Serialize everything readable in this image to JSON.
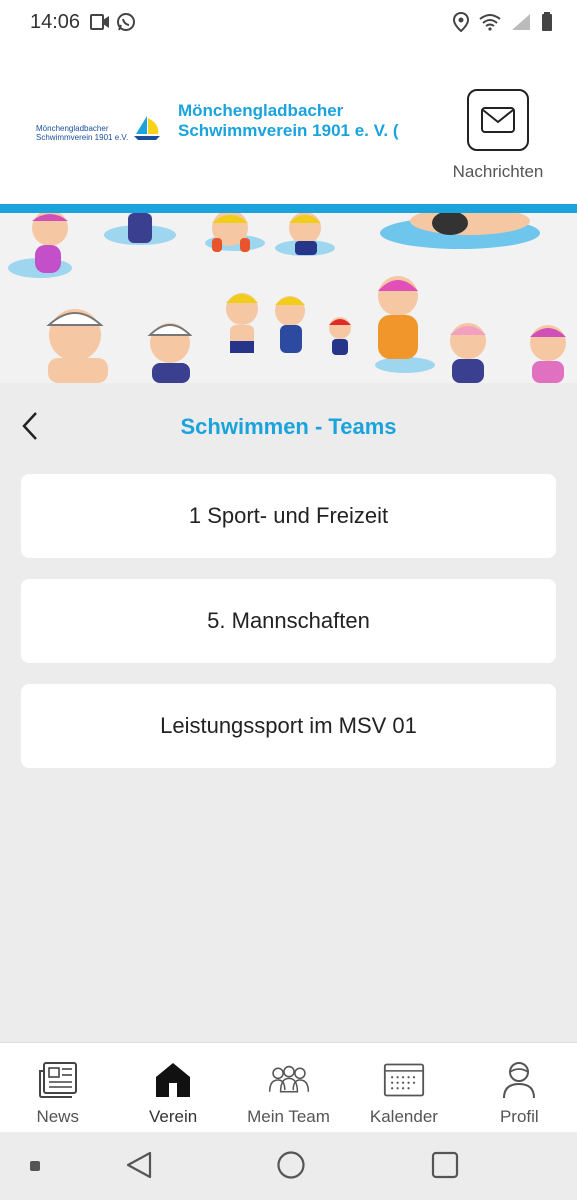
{
  "status": {
    "time": "14:06",
    "icons_left": [
      "video-icon",
      "whatsapp-icon"
    ],
    "icons_right": [
      "location-icon",
      "wifi-icon",
      "signal-icon",
      "battery-icon"
    ]
  },
  "header": {
    "logo_text": "Mönchengladbacher\nSchwimmverein 1901 e.V.",
    "club_title_line1": "Mönchengladbacher",
    "club_title_line2": "Schwimmverein 1901 e. V. (",
    "messages_label": "Nachrichten"
  },
  "page": {
    "title": "Schwimmen - Teams"
  },
  "teams": [
    {
      "label": "1 Sport- und Freizeit"
    },
    {
      "label": "5. Mannschaften"
    },
    {
      "label": "Leistungssport im MSV 01"
    }
  ],
  "bottom_nav": [
    {
      "label": "News",
      "icon": "news-icon",
      "active": false
    },
    {
      "label": "Verein",
      "icon": "home-icon",
      "active": true
    },
    {
      "label": "Mein Team",
      "icon": "team-icon",
      "active": false
    },
    {
      "label": "Kalender",
      "icon": "calendar-icon",
      "active": false
    },
    {
      "label": "Profil",
      "icon": "profile-icon",
      "active": false
    }
  ],
  "colors": {
    "accent": "#1aa3dc",
    "background": "#ececec",
    "card": "#ffffff"
  }
}
